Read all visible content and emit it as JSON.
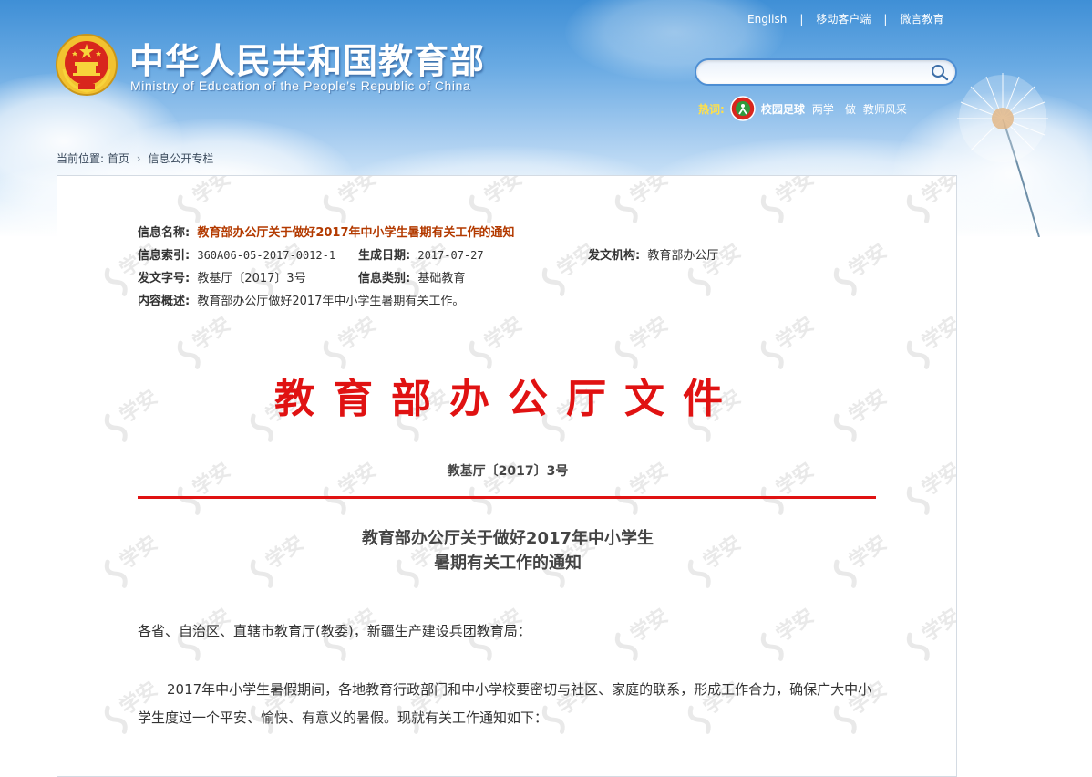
{
  "header": {
    "site_title": "中华人民共和国教育部",
    "site_subtitle": "Ministry of Education of the People's Republic of China",
    "top_links": [
      "English",
      "移动客户端",
      "微言教育"
    ],
    "search": {
      "placeholder": ""
    },
    "hot": {
      "label": "热词:",
      "items": [
        "校园足球",
        "两学一做",
        "教师风采"
      ]
    }
  },
  "breadcrumb": {
    "label": "当前位置:",
    "home": "首页",
    "current": "信息公开专栏"
  },
  "meta": {
    "name_key": "信息名称:",
    "name_value": "教育部办公厅关于做好2017年中小学生暑期有关工作的通知",
    "index_key": "信息索引:",
    "index_value": "360A06-05-2017-0012-1",
    "date_key": "生成日期:",
    "date_value": "2017-07-27",
    "org_key": "发文机构:",
    "org_value": "教育部办公厅",
    "docno_key": "发文字号:",
    "docno_value": "教基厅〔2017〕3号",
    "type_key": "信息类别:",
    "type_value": "基础教育",
    "summary_key": "内容概述:",
    "summary_value": "教育部办公厅做好2017年中小学生暑期有关工作。"
  },
  "document": {
    "header": "教育部办公厅文件",
    "number": "教基厅〔2017〕3号",
    "title_line1": "教育部办公厅关于做好2017年中小学生",
    "title_line2": "暑期有关工作的通知",
    "salutation": "各省、自治区、直辖市教育厅(教委)，新疆生产建设兵团教育局：",
    "paragraph1": "2017年中小学生暑假期间，各地教育行政部门和中小学校要密切与社区、家庭的联系，形成工作合力，确保广大中小学生度过一个平安、愉快、有意义的暑假。现就有关工作通知如下："
  },
  "watermark": {
    "text": "学安"
  },
  "colors": {
    "document_red": "#e01212",
    "title_link": "#b33a00",
    "hot_label": "#ffe04a",
    "sky_blue": "#3f8fd6"
  }
}
